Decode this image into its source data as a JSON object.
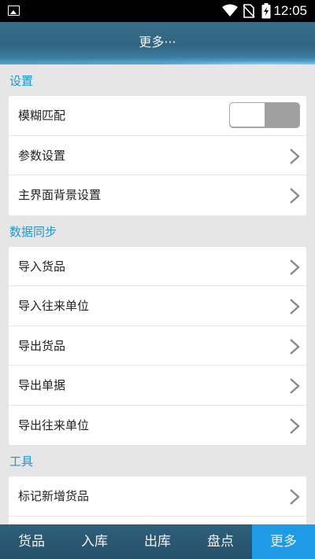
{
  "status_bar": {
    "time": "12:05",
    "icons": [
      "image-icon",
      "wifi-icon",
      "no-sim-icon",
      "battery-charging-icon"
    ]
  },
  "header": {
    "title": "更多···"
  },
  "sections": {
    "settings": {
      "title": "设置",
      "items": [
        {
          "label": "模糊匹配",
          "control": "toggle",
          "toggle_on": false
        },
        {
          "label": "参数设置",
          "control": "chevron"
        },
        {
          "label": "主界面背景设置",
          "control": "chevron"
        }
      ]
    },
    "sync": {
      "title": "数据同步",
      "items": [
        {
          "label": "导入货品"
        },
        {
          "label": "导入往来单位"
        },
        {
          "label": "导出货品"
        },
        {
          "label": "导出单据"
        },
        {
          "label": "导出往来单位"
        }
      ]
    },
    "tools": {
      "title": "工具",
      "items": [
        {
          "label": "标记新增货品"
        }
      ]
    }
  },
  "bottom_nav": {
    "items": [
      {
        "label": "货品"
      },
      {
        "label": "入库"
      },
      {
        "label": "出库"
      },
      {
        "label": "盘点"
      },
      {
        "label": "更多"
      }
    ],
    "active_index": 4
  },
  "colors": {
    "accent": "#1e96d8",
    "nav_active": "#1e9ae6",
    "header": "#2f6482"
  }
}
